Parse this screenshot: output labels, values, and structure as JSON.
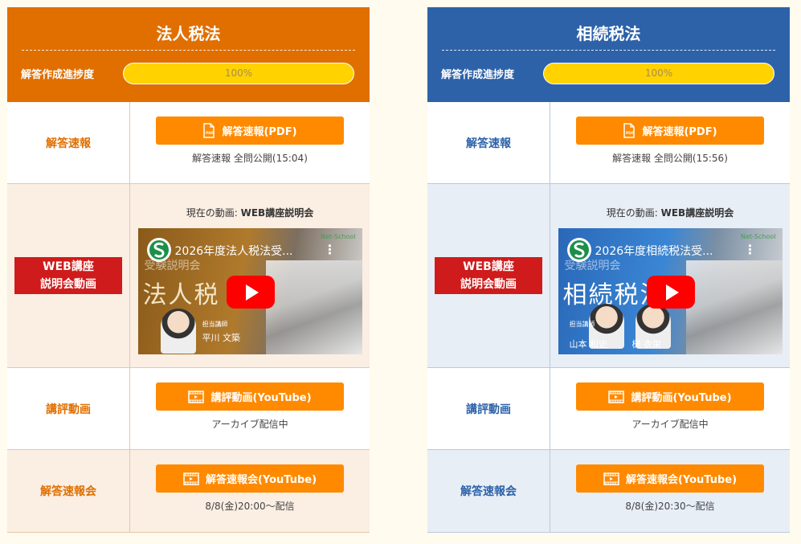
{
  "panels": [
    {
      "title": "法人税法",
      "progress_label": "解答作成進捗度",
      "progress_value": 100,
      "progress_text": "100%",
      "accent": "#e06f00",
      "rows": {
        "answer_flash": {
          "label": "解答速報",
          "button": "解答速報(PDF)",
          "note": "解答速報 全問公開(15:04)"
        },
        "web_seminar": {
          "label_line1": "WEB講座",
          "label_line2": "説明会動画",
          "current_prefix": "現在の動画: ",
          "current_title": "WEB講座説明会",
          "video_title": "2026年度法人税法受...",
          "thumb_text": "法人税",
          "thumb_small": "受験説明会",
          "thumb_name": "平川 文築",
          "thumb_role": "担当講師"
        },
        "review": {
          "label": "講評動画",
          "button": "講評動画(YouTube)",
          "note": "アーカイブ配信中"
        },
        "flash_session": {
          "label": "解答速報会",
          "button": "解答速報会(YouTube)",
          "note": "8/8(金)20:00〜配信"
        }
      }
    },
    {
      "title": "相続税法",
      "progress_label": "解答作成進捗度",
      "progress_value": 100,
      "progress_text": "100%",
      "accent": "#2d62a9",
      "rows": {
        "answer_flash": {
          "label": "解答速報",
          "button": "解答速報(PDF)",
          "note": "解答速報 全問公開(15:56)"
        },
        "web_seminar": {
          "label_line1": "WEB講座",
          "label_line2": "説明会動画",
          "current_prefix": "現在の動画: ",
          "current_title": "WEB講座説明会",
          "video_title": "2026年度相続税法受...",
          "thumb_text": "相続税法",
          "thumb_small": "受験説明会",
          "thumb_name": "山本 和史",
          "thumb_name2": "樋 衣栄",
          "thumb_role": "担当講師"
        },
        "review": {
          "label": "講評動画",
          "button": "講評動画(YouTube)",
          "note": "アーカイブ配信中"
        },
        "flash_session": {
          "label": "解答速報会",
          "button": "解答速報会(YouTube)",
          "note": "8/8(金)20:30〜配信"
        }
      }
    }
  ],
  "icons": {
    "pdf": "pdf-file-icon",
    "video": "film-icon",
    "play": "play-icon",
    "more": "more-vertical-icon",
    "channel": "channel-logo-icon"
  },
  "colors": {
    "button": "#ff8a00",
    "badge": "#cf1b1b",
    "progress_fill": "#ffd200"
  },
  "watermark": "Net-School"
}
